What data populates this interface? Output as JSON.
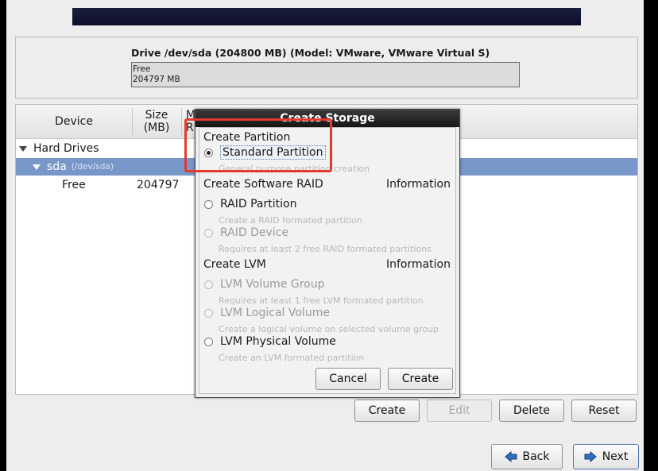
{
  "drive": {
    "title": "Drive /dev/sda (204800 MB) (Model: VMware, VMware Virtual S)",
    "bar_line1": "Free",
    "bar_line2": "204797 MB"
  },
  "table": {
    "headers": {
      "device": "Device",
      "size_line1": "Size",
      "size_line2": "(MB)",
      "mount_line1": "M",
      "mount_line2": "R"
    },
    "rows": {
      "hard_drives": "Hard Drives",
      "sda_name": "sda",
      "sda_path": "(/dev/sda)",
      "free_name": "Free",
      "free_size": "204797"
    }
  },
  "buttons": {
    "create": "Create",
    "edit": "Edit",
    "delete": "Delete",
    "reset": "Reset",
    "back": "Back",
    "next": "Next"
  },
  "dialog": {
    "title": "Create Storage",
    "section_partition": "Create Partition",
    "standard_partition": "Standard Partition",
    "standard_partition_desc": "General purpose partition creation",
    "section_raid": "Create Software RAID",
    "raid_info": "Information",
    "raid_partition": "RAID Partition",
    "raid_partition_desc": "Create a RAID formated partition",
    "raid_device": "RAID Device",
    "raid_device_desc": "Requires at least 2 free RAID formated partitions",
    "section_lvm": "Create LVM",
    "lvm_info": "Information",
    "lvm_volume_group": "LVM Volume Group",
    "lvm_volume_group_desc": "Requires at least 1 free LVM formated partition",
    "lvm_logical_volume": "LVM Logical Volume",
    "lvm_logical_volume_desc": "Create a logical volume on selected volume group",
    "lvm_physical_volume": "LVM Physical Volume",
    "lvm_physical_volume_desc": "Create an LVM formated partition",
    "cancel": "Cancel",
    "create": "Create"
  },
  "colors": {
    "selection": "#7896c8",
    "highlight": "#e33b30",
    "arrow_blue": "#2f6fc0"
  },
  "icons": {
    "back": "left-arrow-icon",
    "next": "right-arrow-icon",
    "expand": "triangle-down-icon"
  }
}
